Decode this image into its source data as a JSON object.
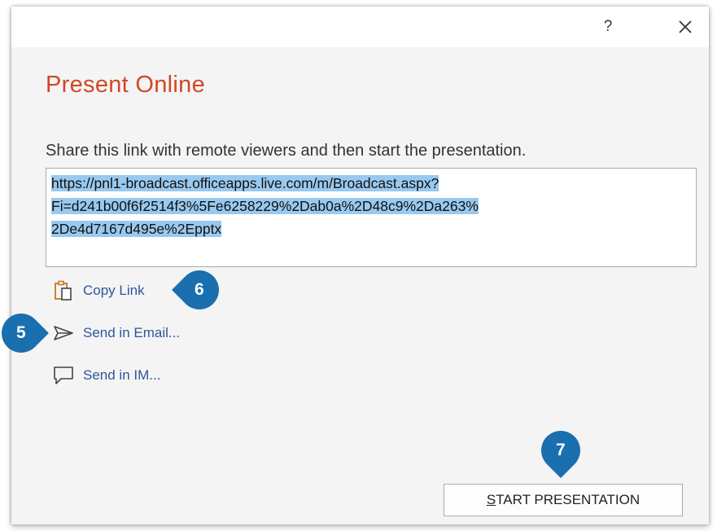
{
  "dialog": {
    "help_label": "?",
    "title": "Present Online",
    "instruction": "Share this link with remote viewers and then start the presentation.",
    "link_lines": [
      "https://pnl1-broadcast.officeapps.live.com/m/Broadcast.aspx?",
      "Fi=d241b00f6f2514f3%5Fe6258229%2Dab0a%2D48c9%2Da263%",
      "2De4d7167d495e%2Epptx"
    ],
    "actions": [
      {
        "label": "Copy Link",
        "icon": "clipboard-icon"
      },
      {
        "label": "Send in Email...",
        "icon": "send-arrow-icon"
      },
      {
        "label": "Send in IM...",
        "icon": "chat-bubble-icon"
      }
    ],
    "start_button": {
      "accel": "S",
      "rest": "TART PRESENTATION"
    }
  },
  "callouts": {
    "copy_link": "6",
    "send_email": "5",
    "start": "7"
  },
  "colors": {
    "title": "#d24726",
    "link": "#2b579a",
    "selection": "#99c9ef",
    "badge": "#1a6fae",
    "dialog_bg": "#f4f4f4"
  }
}
